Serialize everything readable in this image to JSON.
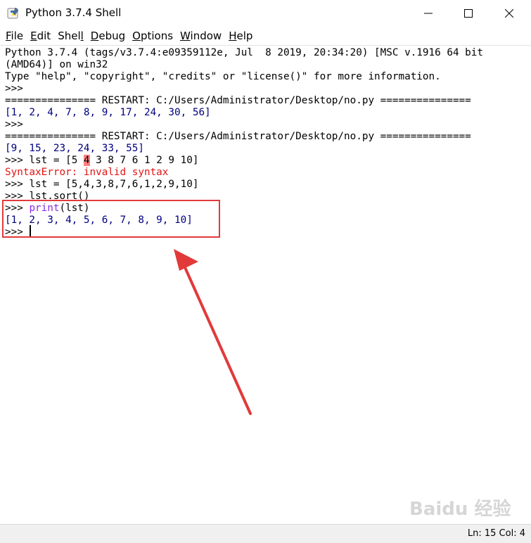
{
  "window": {
    "title": "Python 3.7.4 Shell"
  },
  "menu": {
    "items": [
      {
        "label": "File",
        "u": "F",
        "rest": "ile"
      },
      {
        "label": "Edit",
        "u": "E",
        "rest": "dit"
      },
      {
        "label": "Shell",
        "pre": "Shel",
        "u": "l",
        "rest": ""
      },
      {
        "label": "Debug",
        "u": "D",
        "rest": "ebug"
      },
      {
        "label": "Options",
        "u": "O",
        "rest": "ptions"
      },
      {
        "label": "Window",
        "u": "W",
        "rest": "indow"
      },
      {
        "label": "Help",
        "u": "H",
        "rest": "elp"
      }
    ]
  },
  "shell": {
    "l1": "Python 3.7.4 (tags/v3.7.4:e09359112e, Jul  8 2019, 20:34:20) [MSC v.1916 64 bit",
    "l2": "(AMD64)] on win32",
    "l3": "Type \"help\", \"copyright\", \"credits\" or \"license()\" for more information.",
    "prompt": ">>> ",
    "restart": "=============== RESTART: C:/Users/Administrator/Desktop/no.py ===============",
    "out1": "[1, 2, 4, 7, 8, 9, 17, 24, 30, 56]",
    "out2": "[9, 15, 23, 24, 33, 55]",
    "cmd1_a": "lst = [5 ",
    "cmd1_err": "4",
    "cmd1_b": " 3 8 7 6 1 2 9 10]",
    "error": "SyntaxError: invalid syntax",
    "cmd2": "lst = [5,4,3,8,7,6,1,2,9,10]",
    "cmd3": "lst.sort()",
    "cmd4_fn": "print",
    "cmd4_rest": "(lst)",
    "out3": "[1, 2, 3, 4, 5, 6, 7, 8, 9, 10]"
  },
  "status": {
    "position": "Ln: 15   Col: 4"
  },
  "colors": {
    "annotation": "#e23a3a",
    "output": "#00007f",
    "error": "#e01515",
    "prompt": "#7f0000",
    "builtin": "#8a2be2"
  }
}
